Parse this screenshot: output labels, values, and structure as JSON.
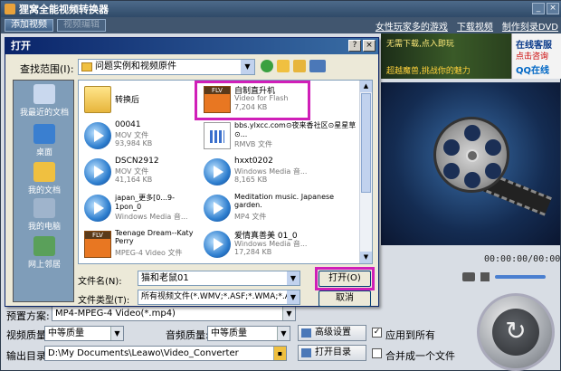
{
  "app": {
    "title": "狸窝全能视频转换器",
    "toolbar": {
      "add_video": "添加视频",
      "edit_video": "视频编辑"
    },
    "links": [
      "女性玩家多的游戏",
      "下载视频",
      "制作刻录DVD"
    ],
    "ad": {
      "line1": "无需下载,点入即玩",
      "line2": "超越魔兽,挑战你的魅力",
      "side1": "在线客服",
      "side2": "点击咨询",
      "side3": "QQ在线"
    },
    "time_display": "00:00:00/00:00:00",
    "bottom": {
      "preset_label": "预置方案:",
      "preset_value": "MP4-MPEG-4 Video(*.mp4)",
      "video_quality_label": "视频质量:",
      "video_quality_value": "中等质量",
      "audio_quality_label": "音频质量:",
      "audio_quality_value": "中等质量",
      "advanced_button": "高级设置",
      "apply_all_label": "应用到所有",
      "apply_all_checked": true,
      "output_label": "输出目录:",
      "output_path": "D:\\My Documents\\Leawo\\Video_Converter",
      "open_dir_button": "打开目录",
      "merge_label": "合并成一个文件",
      "merge_checked": false
    }
  },
  "dialog": {
    "title": "打开",
    "look_in_label": "查找范围(I):",
    "look_in_value": "问题实例和视频原件",
    "places": [
      "我最近的文档",
      "桌面",
      "我的文档",
      "我的电脑",
      "网上邻居"
    ],
    "files": [
      {
        "name": "转换后",
        "type": "",
        "size": "",
        "icon": "folder-icon"
      },
      {
        "name": "自制直升机",
        "type": "Video for Flash",
        "size": "7,204 KB",
        "icon": "flv-icon"
      },
      {
        "name": "00041",
        "type": "MOV 文件",
        "size": "93,984 KB",
        "icon": "media-player-icon"
      },
      {
        "name": "bbs.ylxcc.com⊙夜来香社区⊙星星草⊙...",
        "type": "RMVB 文件",
        "size": "",
        "icon": "rmvb-icon"
      },
      {
        "name": "DSCN2912",
        "type": "MOV 文件",
        "size": "41,164 KB",
        "icon": "media-player-icon"
      },
      {
        "name": "hxxt0202",
        "type": "Windows Media 音...",
        "size": "8,165 KB",
        "icon": "media-player-icon"
      },
      {
        "name": "japan_更多[0...9-1pon_0",
        "type": "Windows Media 音...",
        "size": "",
        "icon": "media-player-icon"
      },
      {
        "name": "Meditation music. Japanese garden.",
        "type": "MP4 文件",
        "size": "",
        "icon": "media-player-icon"
      },
      {
        "name": "Teenage Dream--Katy Perry",
        "type": "MPEG-4 Video 文件",
        "size": "",
        "icon": "flv-icon"
      },
      {
        "name": "爱情真善美 01_0",
        "type": "Windows Media 音...",
        "size": "17,284 KB",
        "icon": "media-player-icon"
      }
    ],
    "filename_label": "文件名(N):",
    "filename_value": "猫和老鼠01",
    "filetype_label": "文件类型(T):",
    "filetype_value": "所有视频文件(*.WMV;*.ASF;*.WMA;*.AVI;",
    "open_button": "打开(O)",
    "cancel_button": "取消"
  }
}
